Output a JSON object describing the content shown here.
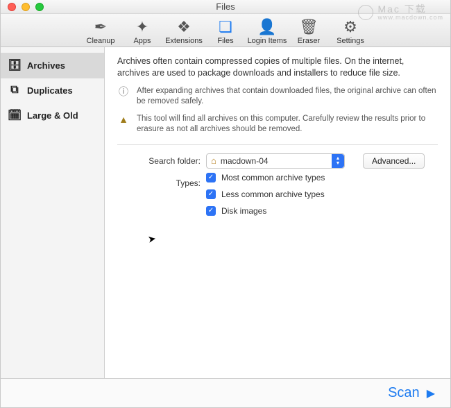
{
  "window_title": "Files",
  "watermark": {
    "big": "Mac 下载",
    "small": "www.macdown.com"
  },
  "toolbar": {
    "items": [
      {
        "id": "cleanup",
        "label": "Cleanup",
        "icon": "✒︎"
      },
      {
        "id": "apps",
        "label": "Apps",
        "icon": "✦"
      },
      {
        "id": "extensions",
        "label": "Extensions",
        "icon": "❖"
      },
      {
        "id": "files",
        "label": "Files",
        "icon": "❏",
        "selected": true
      },
      {
        "id": "login-items",
        "label": "Login Items",
        "icon": "👤"
      },
      {
        "id": "eraser",
        "label": "Eraser",
        "icon": "🗑"
      },
      {
        "id": "settings",
        "label": "Settings",
        "icon": "⚙"
      }
    ]
  },
  "sidebar": {
    "items": [
      {
        "id": "archives",
        "label": "Archives",
        "icon": "🗄",
        "selected": true
      },
      {
        "id": "duplicates",
        "label": "Duplicates",
        "icon": "⧉",
        "selected": false
      },
      {
        "id": "large-old",
        "label": "Large & Old",
        "icon": "🗓",
        "selected": false
      }
    ]
  },
  "main": {
    "intro": "Archives often contain compressed copies of multiple files. On the internet, archives are used to package downloads and installers to reduce file size.",
    "info_hint": "After expanding archives that contain downloaded files, the original archive can often be removed safely.",
    "warn_hint": "This tool will find all archives on this computer. Carefully review the results prior to erasure as not all archives should be removed.",
    "search_label": "Search folder:",
    "search_value": "macdown-04",
    "advanced_label": "Advanced...",
    "types_label": "Types:",
    "types": [
      {
        "label": "Most common archive types",
        "checked": true
      },
      {
        "label": "Less common archive types",
        "checked": true
      },
      {
        "label": "Disk images",
        "checked": true
      }
    ]
  },
  "footer": {
    "scan_label": "Scan"
  }
}
